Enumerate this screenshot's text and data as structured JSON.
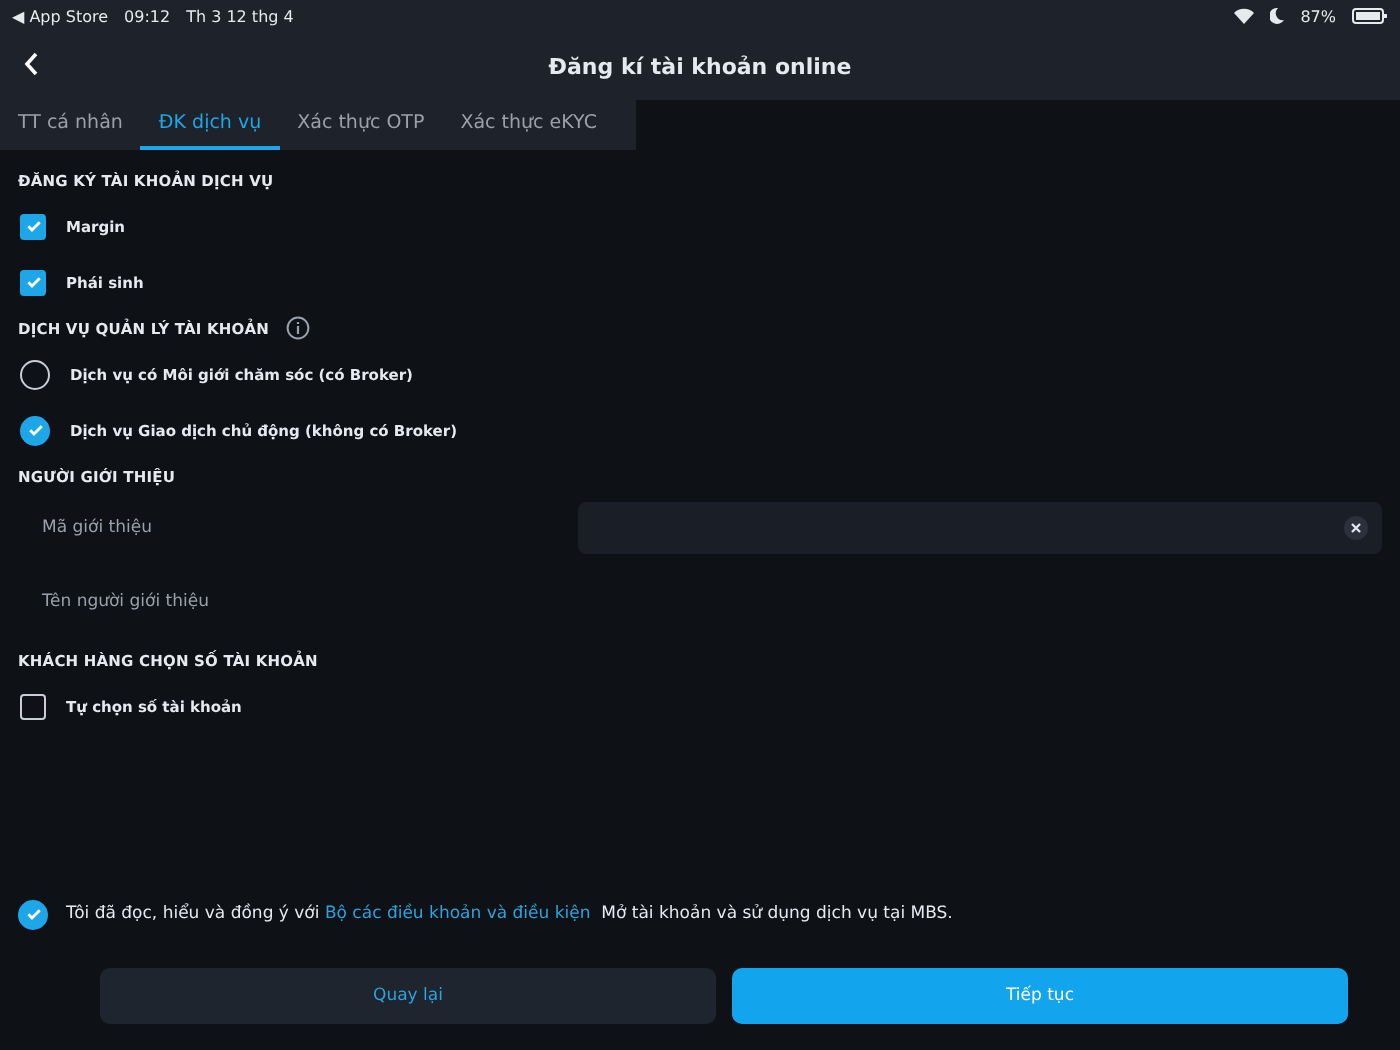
{
  "status_bar": {
    "back_app": "◀ App Store",
    "time": "09:12",
    "date": "Th 3 12 thg 4",
    "battery": "87%"
  },
  "header": {
    "title": "Đăng kí tài khoản online"
  },
  "tabs": [
    {
      "label": "TT cá nhân",
      "selected": false
    },
    {
      "label": "ĐK dịch vụ",
      "selected": true
    },
    {
      "label": "Xác thực OTP",
      "selected": false
    },
    {
      "label": "Xác thực eKYC",
      "selected": false
    }
  ],
  "sections": [
    {
      "heading": "ĐĂNG KÝ TÀI KHOẢN DỊCH VỤ",
      "info": false,
      "items": [
        {
          "kind": "checkbox",
          "label": "Margin",
          "checked": true
        },
        {
          "kind": "checkbox",
          "label": "Phái sinh",
          "checked": true
        }
      ]
    },
    {
      "heading": "DỊCH VỤ QUẢN LÝ TÀI KHOẢN",
      "info": true,
      "items": [
        {
          "kind": "radio",
          "label": "Dịch vụ có Môi giới chăm sóc (có Broker)",
          "selected": false
        },
        {
          "kind": "radio",
          "label": "Dịch vụ Giao dịch chủ động (không có Broker)",
          "selected": true
        }
      ]
    },
    {
      "heading": "NGƯỜI GIỚI THIỆU",
      "info": false,
      "items": [
        {
          "kind": "field",
          "label": "Mã giới thiệu"
        },
        {
          "kind": "readonly",
          "label": "Tên người giới thiệu"
        }
      ]
    },
    {
      "heading": "KHÁCH HÀNG CHỌN SỐ TÀI KHOẢN",
      "info": false,
      "items": [
        {
          "kind": "checkbox",
          "label": "Tự chọn số tài khoản",
          "checked": false
        }
      ]
    }
  ],
  "agreement": {
    "checked": true,
    "text_before": "Tôi đã đọc, hiểu và đồng ý với",
    "link": "Bộ các điều khoản và điều kiện",
    "text_after": "Mở tài khoản và sử dụng dịch vụ tại MBS."
  },
  "buttons": [
    {
      "label": "Quay lại",
      "kind": "secondary"
    },
    {
      "label": "Tiếp tục",
      "kind": "primary"
    }
  ]
}
